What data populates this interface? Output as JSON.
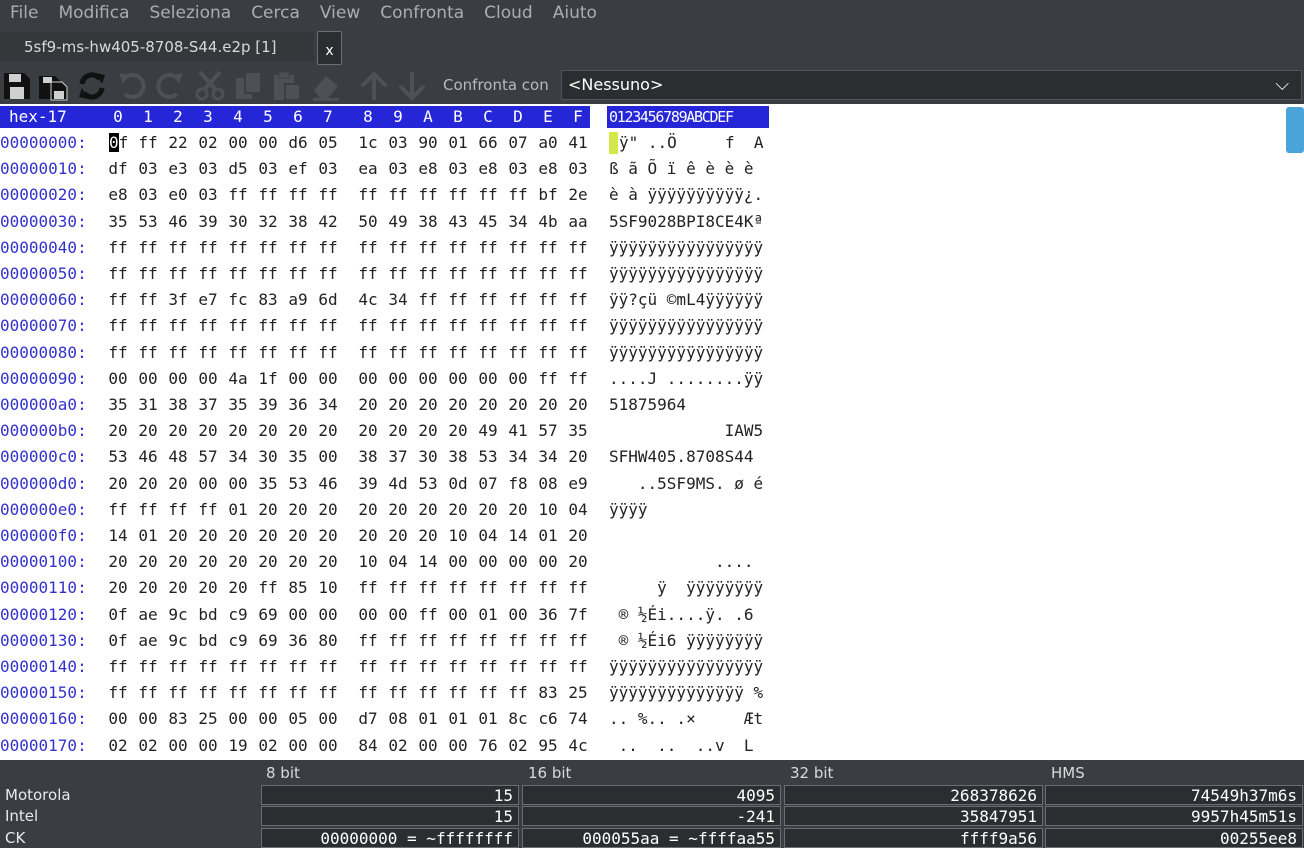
{
  "menu": [
    "File",
    "Modifica",
    "Seleziona",
    "Cerca",
    "View",
    "Confronta",
    "Cloud",
    "Aiuto"
  ],
  "tab": {
    "title": "5sf9-ms-hw405-8708-S44.e2p [1]",
    "close": "x"
  },
  "toolbar": {
    "icons": [
      "save-icon",
      "save-as-icon",
      "reload-icon",
      "undo-icon",
      "redo-icon",
      "cut-icon",
      "copy-icon",
      "paste-icon",
      "erase-icon",
      "arrow-up-icon",
      "arrow-down-icon"
    ],
    "compare_label": "Confronta con",
    "compare_value": "<Nessuno>"
  },
  "hex": {
    "corner": "hex-17",
    "columns": [
      "0",
      "1",
      "2",
      "3",
      "4",
      "5",
      "6",
      "7",
      "8",
      "9",
      "A",
      "B",
      "C",
      "D",
      "E",
      "F"
    ],
    "ascii_header": "0123456789ABCDEF",
    "rows": [
      {
        "offset": "00000000:",
        "bytes": [
          "0f",
          "ff",
          "22",
          "02",
          "00",
          "00",
          "d6",
          "05",
          "1c",
          "03",
          "90",
          "01",
          "66",
          "07",
          "a0",
          "41"
        ],
        "ascii": "ÿ\" ..Ö     f  A"
      },
      {
        "offset": "00000010:",
        "bytes": [
          "df",
          "03",
          "e3",
          "03",
          "d5",
          "03",
          "ef",
          "03",
          "ea",
          "03",
          "e8",
          "03",
          "e8",
          "03",
          "e8",
          "03"
        ],
        "ascii": "ß ã Õ ï ê è è è"
      },
      {
        "offset": "00000020:",
        "bytes": [
          "e8",
          "03",
          "e0",
          "03",
          "ff",
          "ff",
          "ff",
          "ff",
          "ff",
          "ff",
          "ff",
          "ff",
          "ff",
          "ff",
          "bf",
          "2e"
        ],
        "ascii": "è à ÿÿÿÿÿÿÿÿÿÿ¿."
      },
      {
        "offset": "00000030:",
        "bytes": [
          "35",
          "53",
          "46",
          "39",
          "30",
          "32",
          "38",
          "42",
          "50",
          "49",
          "38",
          "43",
          "45",
          "34",
          "4b",
          "aa"
        ],
        "ascii": "5SF9028BPI8CE4Kª"
      },
      {
        "offset": "00000040:",
        "bytes": [
          "ff",
          "ff",
          "ff",
          "ff",
          "ff",
          "ff",
          "ff",
          "ff",
          "ff",
          "ff",
          "ff",
          "ff",
          "ff",
          "ff",
          "ff",
          "ff"
        ],
        "ascii": "ÿÿÿÿÿÿÿÿÿÿÿÿÿÿÿÿ"
      },
      {
        "offset": "00000050:",
        "bytes": [
          "ff",
          "ff",
          "ff",
          "ff",
          "ff",
          "ff",
          "ff",
          "ff",
          "ff",
          "ff",
          "ff",
          "ff",
          "ff",
          "ff",
          "ff",
          "ff"
        ],
        "ascii": "ÿÿÿÿÿÿÿÿÿÿÿÿÿÿÿÿ"
      },
      {
        "offset": "00000060:",
        "bytes": [
          "ff",
          "ff",
          "3f",
          "e7",
          "fc",
          "83",
          "a9",
          "6d",
          "4c",
          "34",
          "ff",
          "ff",
          "ff",
          "ff",
          "ff",
          "ff"
        ],
        "ascii": "ÿÿ?çü ©mL4ÿÿÿÿÿÿ"
      },
      {
        "offset": "00000070:",
        "bytes": [
          "ff",
          "ff",
          "ff",
          "ff",
          "ff",
          "ff",
          "ff",
          "ff",
          "ff",
          "ff",
          "ff",
          "ff",
          "ff",
          "ff",
          "ff",
          "ff"
        ],
        "ascii": "ÿÿÿÿÿÿÿÿÿÿÿÿÿÿÿÿ"
      },
      {
        "offset": "00000080:",
        "bytes": [
          "ff",
          "ff",
          "ff",
          "ff",
          "ff",
          "ff",
          "ff",
          "ff",
          "ff",
          "ff",
          "ff",
          "ff",
          "ff",
          "ff",
          "ff",
          "ff"
        ],
        "ascii": "ÿÿÿÿÿÿÿÿÿÿÿÿÿÿÿÿ"
      },
      {
        "offset": "00000090:",
        "bytes": [
          "00",
          "00",
          "00",
          "00",
          "4a",
          "1f",
          "00",
          "00",
          "00",
          "00",
          "00",
          "00",
          "00",
          "00",
          "ff",
          "ff"
        ],
        "ascii": "....J ........ÿÿ"
      },
      {
        "offset": "000000a0:",
        "bytes": [
          "35",
          "31",
          "38",
          "37",
          "35",
          "39",
          "36",
          "34",
          "20",
          "20",
          "20",
          "20",
          "20",
          "20",
          "20",
          "20"
        ],
        "ascii": "51875964"
      },
      {
        "offset": "000000b0:",
        "bytes": [
          "20",
          "20",
          "20",
          "20",
          "20",
          "20",
          "20",
          "20",
          "20",
          "20",
          "20",
          "20",
          "49",
          "41",
          "57",
          "35"
        ],
        "ascii": "            IAW5"
      },
      {
        "offset": "000000c0:",
        "bytes": [
          "53",
          "46",
          "48",
          "57",
          "34",
          "30",
          "35",
          "00",
          "38",
          "37",
          "30",
          "38",
          "53",
          "34",
          "34",
          "20"
        ],
        "ascii": "SFHW405.8708S44"
      },
      {
        "offset": "000000d0:",
        "bytes": [
          "20",
          "20",
          "20",
          "00",
          "00",
          "35",
          "53",
          "46",
          "39",
          "4d",
          "53",
          "0d",
          "07",
          "f8",
          "08",
          "e9"
        ],
        "ascii": "   ..5SF9MS. ø é"
      },
      {
        "offset": "000000e0:",
        "bytes": [
          "ff",
          "ff",
          "ff",
          "ff",
          "01",
          "20",
          "20",
          "20",
          "20",
          "20",
          "20",
          "20",
          "20",
          "20",
          "10",
          "04"
        ],
        "ascii": "ÿÿÿÿ"
      },
      {
        "offset": "000000f0:",
        "bytes": [
          "14",
          "01",
          "20",
          "20",
          "20",
          "20",
          "20",
          "20",
          "20",
          "20",
          "20",
          "10",
          "04",
          "14",
          "01",
          "20"
        ],
        "ascii": ""
      },
      {
        "offset": "00000100:",
        "bytes": [
          "20",
          "20",
          "20",
          "20",
          "20",
          "20",
          "20",
          "20",
          "10",
          "04",
          "14",
          "00",
          "00",
          "00",
          "00",
          "20"
        ],
        "ascii": "           ...."
      },
      {
        "offset": "00000110:",
        "bytes": [
          "20",
          "20",
          "20",
          "20",
          "20",
          "ff",
          "85",
          "10",
          "ff",
          "ff",
          "ff",
          "ff",
          "ff",
          "ff",
          "ff",
          "ff"
        ],
        "ascii": "     ÿ  ÿÿÿÿÿÿÿÿ"
      },
      {
        "offset": "00000120:",
        "bytes": [
          "0f",
          "ae",
          "9c",
          "bd",
          "c9",
          "69",
          "00",
          "00",
          "00",
          "00",
          "ff",
          "00",
          "01",
          "00",
          "36",
          "7f"
        ],
        "ascii": " ® ½Éi....ÿ. .6"
      },
      {
        "offset": "00000130:",
        "bytes": [
          "0f",
          "ae",
          "9c",
          "bd",
          "c9",
          "69",
          "36",
          "80",
          "ff",
          "ff",
          "ff",
          "ff",
          "ff",
          "ff",
          "ff",
          "ff"
        ],
        "ascii": " ® ½Éi6 ÿÿÿÿÿÿÿÿ"
      },
      {
        "offset": "00000140:",
        "bytes": [
          "ff",
          "ff",
          "ff",
          "ff",
          "ff",
          "ff",
          "ff",
          "ff",
          "ff",
          "ff",
          "ff",
          "ff",
          "ff",
          "ff",
          "ff",
          "ff"
        ],
        "ascii": "ÿÿÿÿÿÿÿÿÿÿÿÿÿÿÿÿ"
      },
      {
        "offset": "00000150:",
        "bytes": [
          "ff",
          "ff",
          "ff",
          "ff",
          "ff",
          "ff",
          "ff",
          "ff",
          "ff",
          "ff",
          "ff",
          "ff",
          "ff",
          "ff",
          "83",
          "25"
        ],
        "ascii": "ÿÿÿÿÿÿÿÿÿÿÿÿÿÿ %"
      },
      {
        "offset": "00000160:",
        "bytes": [
          "00",
          "00",
          "83",
          "25",
          "00",
          "00",
          "05",
          "00",
          "d7",
          "08",
          "01",
          "01",
          "01",
          "8c",
          "c6",
          "74"
        ],
        "ascii": ".. %.. .×     Æt"
      },
      {
        "offset": "00000170:",
        "bytes": [
          "02",
          "02",
          "00",
          "00",
          "19",
          "02",
          "00",
          "00",
          "84",
          "02",
          "00",
          "00",
          "76",
          "02",
          "95",
          "4c"
        ],
        "ascii": " ..  ..  ..v  L"
      }
    ]
  },
  "status": {
    "col_headers": [
      "8 bit",
      "16 bit",
      "32 bit",
      "HMS"
    ],
    "rows": [
      {
        "label": "Motorola",
        "values": [
          "15",
          "4095",
          "268378626",
          "74549h37m6s"
        ]
      },
      {
        "label": "Intel",
        "values": [
          "15",
          "-241",
          "35847951",
          "9957h45m51s"
        ]
      },
      {
        "label": "CK",
        "values": [
          "00000000 = ~ffffffff",
          "000055aa = ~ffffaa55",
          "ffff9a56",
          "00255ee8"
        ]
      }
    ]
  }
}
